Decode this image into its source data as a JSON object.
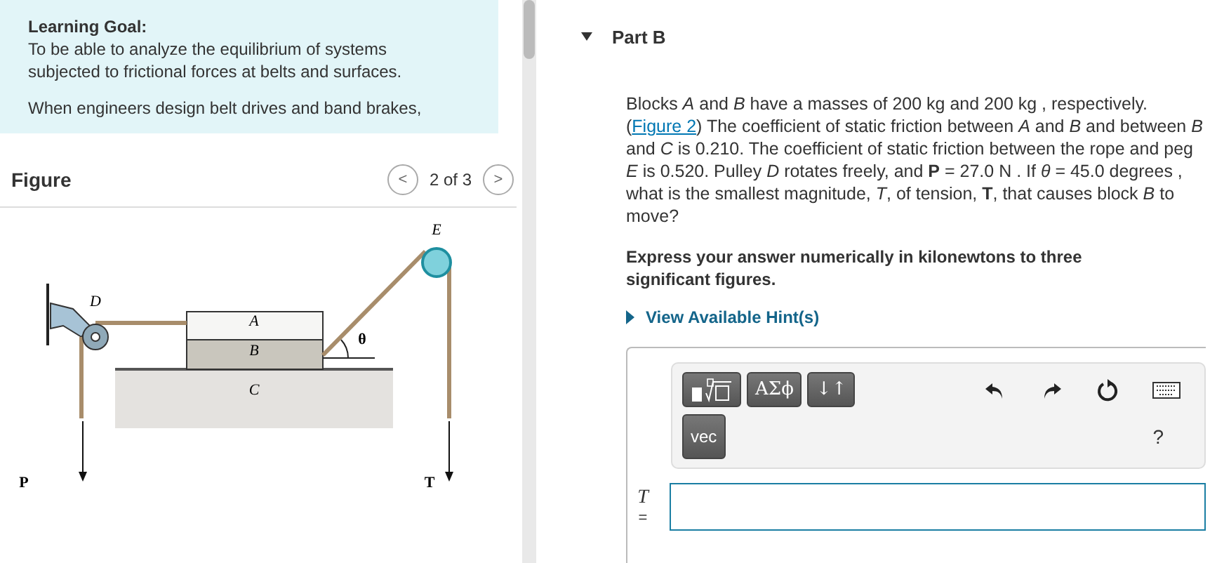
{
  "learning_goal": {
    "heading": "Learning Goal:",
    "text": "To be able to analyze the equilibrium of systems subjected to frictional forces at belts and surfaces.",
    "paragraph": "When engineers design belt drives and band brakes,"
  },
  "figure": {
    "title": "Figure",
    "counter": "2 of 3",
    "prev": "<",
    "next": ">",
    "labels": [
      {
        "kind": "italic",
        "text": "D"
      },
      {
        "kind": "italic",
        "text": "A"
      },
      {
        "kind": "italic",
        "text": "B"
      },
      {
        "kind": "italic",
        "text": "C"
      },
      {
        "kind": "bold",
        "text": "θ"
      },
      {
        "kind": "italic",
        "text": "E"
      },
      {
        "kind": "bold",
        "text": "P"
      },
      {
        "kind": "bold",
        "text": "T"
      }
    ]
  },
  "part": {
    "title": "Part B",
    "expanded": true,
    "problem_before": "Blocks *A* and *B* have a masses of 200 kg and 200 kg , respectively.(",
    "problem_link": "Figure 2",
    "problem_after": ") The coefficient of static friction between *A* and *B* and between *B* and *C* is 0.210. The coefficient of static friction between the rope and peg *E* is 0.520. Pulley *D* rotates freely, and **P** = 27.0 N . If *θ* = 45.0 degrees , what is the smallest magnitude, *T*, of tension, **T**, that causes block *B* to move?",
    "instruction": "Express your answer numerically in kilonewtons to three significant figures.",
    "hint": "View Available Hint(s)",
    "toolbar": [
      {
        "kind": "template"
      },
      {
        "kind": "text",
        "text": "ΑΣϕ"
      },
      {
        "kind": "text",
        "text": "↓↑"
      }
    ],
    "vec": "vec",
    "help": "?",
    "answer_label": "T",
    "answer_equals": "="
  }
}
